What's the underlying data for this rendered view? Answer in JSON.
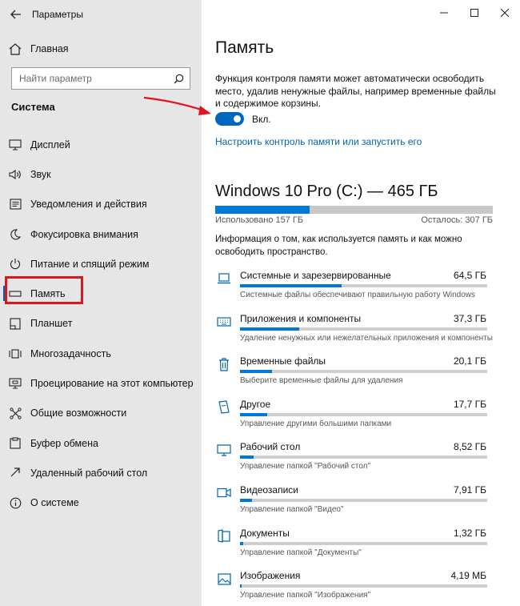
{
  "window": {
    "title": "Параметры"
  },
  "sidebar": {
    "home": "Главная",
    "search_placeholder": "Найти параметр",
    "section": "Система",
    "items": [
      {
        "label": "Дисплей",
        "icon": "display-icon"
      },
      {
        "label": "Звук",
        "icon": "sound-icon"
      },
      {
        "label": "Уведомления и действия",
        "icon": "notifications-icon"
      },
      {
        "label": "Фокусировка внимания",
        "icon": "moon-icon"
      },
      {
        "label": "Питание и спящий режим",
        "icon": "power-icon"
      },
      {
        "label": "Память",
        "icon": "storage-icon",
        "active": true
      },
      {
        "label": "Планшет",
        "icon": "tablet-icon"
      },
      {
        "label": "Многозадачность",
        "icon": "multitasking-icon"
      },
      {
        "label": "Проецирование на этот компьютер",
        "icon": "projecting-icon"
      },
      {
        "label": "Общие возможности",
        "icon": "shared-experiences-icon"
      },
      {
        "label": "Буфер обмена",
        "icon": "clipboard-icon"
      },
      {
        "label": "Удаленный рабочий стол",
        "icon": "remote-desktop-icon"
      },
      {
        "label": "О системе",
        "icon": "info-icon"
      }
    ]
  },
  "main": {
    "title": "Память",
    "description": "Функция контроля памяти может автоматически освободить место, удалив ненужные файлы, например временные файлы и содержимое корзины.",
    "toggle_state": "on",
    "toggle_label": "Вкл.",
    "configure_link": "Настроить контроль памяти или запустить его",
    "drive": {
      "title": "Windows 10 Pro (C:) — 465 ГБ",
      "used_fraction": 0.34,
      "used_label": "Использовано 157 ГБ",
      "free_label": "Осталось: 307 ГБ"
    },
    "info": "Информация о том, как используется память и как можно освободить пространство.",
    "categories": [
      {
        "name": "Системные и зарезервированные",
        "size": "64,5 ГБ",
        "desc": "Системные файлы обеспечивают правильную работу Windows",
        "fraction": 0.41,
        "icon": "laptop-icon"
      },
      {
        "name": "Приложения и компоненты",
        "size": "37,3 ГБ",
        "desc": "Удаление ненужных или нежелательных приложения и компоненты",
        "fraction": 0.24,
        "icon": "keyboard-icon"
      },
      {
        "name": "Временные файлы",
        "size": "20,1 ГБ",
        "desc": "Выберите временные файлы для удаления",
        "fraction": 0.13,
        "icon": "trash-icon"
      },
      {
        "name": "Другое",
        "size": "17,7 ГБ",
        "desc": "Управление другими большими папками",
        "fraction": 0.11,
        "icon": "document-icon"
      },
      {
        "name": "Рабочий стол",
        "size": "8,52 ГБ",
        "desc": "Управление папкой \"Рабочий стол\"",
        "fraction": 0.055,
        "icon": "monitor-icon"
      },
      {
        "name": "Видеозаписи",
        "size": "7,91 ГБ",
        "desc": "Управление папкой \"Видео\"",
        "fraction": 0.05,
        "icon": "video-icon"
      },
      {
        "name": "Документы",
        "size": "1,32 ГБ",
        "desc": "Управление папкой \"Документы\"",
        "fraction": 0.012,
        "icon": "folder-icon"
      },
      {
        "name": "Изображения",
        "size": "4,19 МБ",
        "desc": "Управление папкой \"Изображения\"",
        "fraction": 0.004,
        "icon": "image-icon"
      }
    ]
  },
  "colors": {
    "accent": "#0078d7",
    "annotation": "#e0141e",
    "sidebar_bg": "#e6e6e6"
  }
}
